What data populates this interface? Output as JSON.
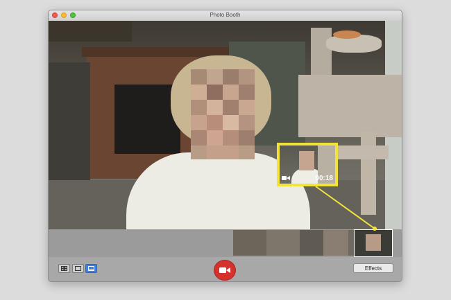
{
  "window": {
    "title": "Photo Booth"
  },
  "callout": {
    "timer": "00:18",
    "icon": "video-camera-icon",
    "accent": "#f2e33a"
  },
  "toolbar": {
    "view_buttons": [
      "grid-view-icon",
      "single-view-icon",
      "strip-view-icon"
    ],
    "record_icon": "video-camera-icon",
    "record_color": "#d5322e",
    "effects_label": "Effects"
  },
  "strip": {
    "active_timer": "00:18"
  }
}
